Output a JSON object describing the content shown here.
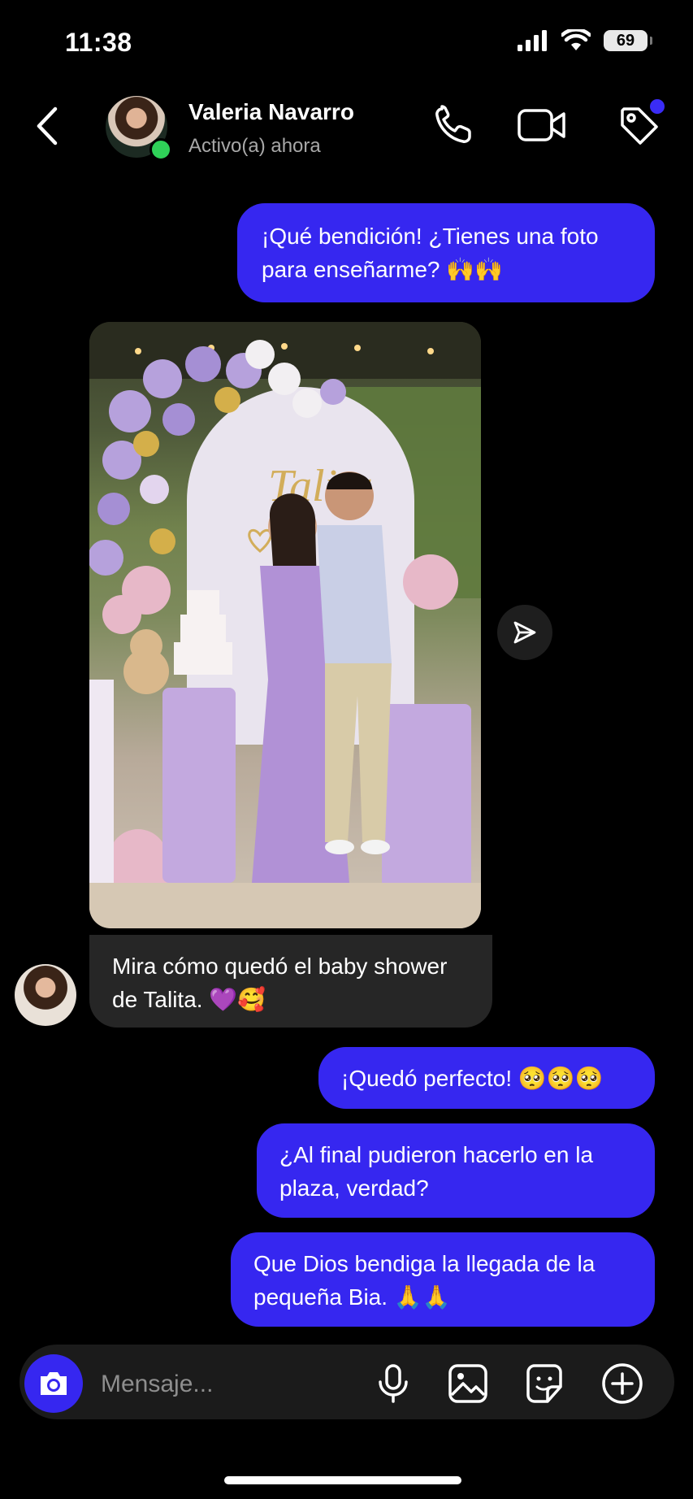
{
  "status_bar": {
    "time": "11:38",
    "battery": "69"
  },
  "header": {
    "contact_name": "Valeria Navarro",
    "contact_status": "Activo(a) ahora"
  },
  "messages": [
    {
      "from": "me",
      "text": "¡Qué bendición! ¿Tienes una foto para enseñarme? 🙌🙌"
    },
    {
      "from": "them",
      "type": "photo"
    },
    {
      "from": "them",
      "text": "Mira cómo quedó el baby shower de Talita. 💜🥰"
    },
    {
      "from": "me",
      "text": "¡Quedó perfecto! 🥺🥺🥺"
    },
    {
      "from": "me",
      "text": "¿Al final pudieron hacerlo en la plaza, verdad?"
    },
    {
      "from": "me",
      "text": "Que Dios bendiga la llegada de la pequeña Bia. 🙏🙏"
    }
  ],
  "photo_sign_text": "Talita",
  "composer": {
    "placeholder": "Mensaje..."
  },
  "colors": {
    "accent": "#3627f0",
    "incoming_bubble": "#262626",
    "online": "#2fd158"
  },
  "icons": [
    "back-chevron-icon",
    "phone-icon",
    "video-camera-icon",
    "tag-icon",
    "send-icon",
    "camera-icon",
    "microphone-icon",
    "image-icon",
    "sticker-icon",
    "plus-circle-icon"
  ]
}
